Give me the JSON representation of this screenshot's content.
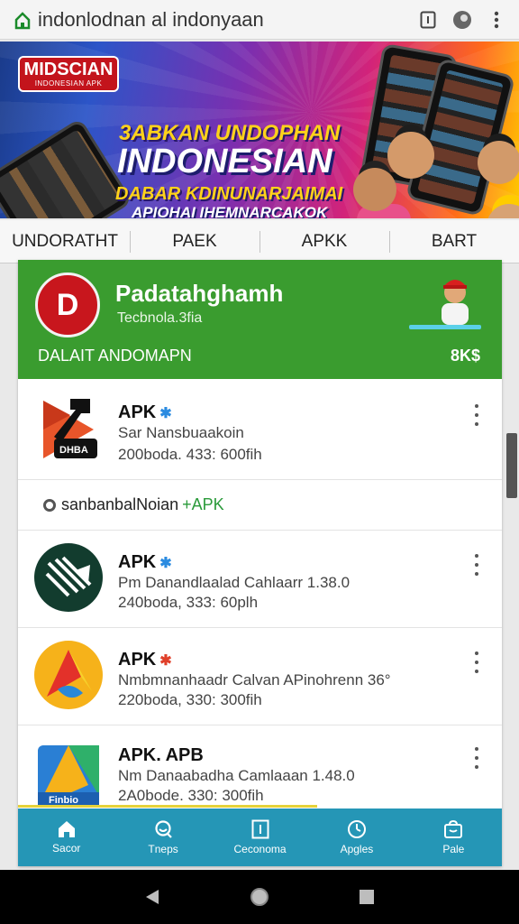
{
  "browser": {
    "url": "indonlodnan al indonyaan"
  },
  "banner": {
    "badge": "MIDSCIAN",
    "badge_sub": "INDONESIAN APK",
    "line1": "3ABKAN UNDOPHAN",
    "line2": "INDONESIAN",
    "line3": "DABAR KDINUNARJAIMAI",
    "line4": "APIOHAI IHEMNARCAKOK"
  },
  "tabs": [
    {
      "label": "UNDORATHT"
    },
    {
      "label": "PAEK"
    },
    {
      "label": "APKK"
    },
    {
      "label": "BART"
    }
  ],
  "header": {
    "logo_letter": "D",
    "title": "Padatahghamh",
    "subtitle": "Tecbnola.3fia",
    "footer_left": "DALAIT ANDOMAPN",
    "footer_right": "8K$"
  },
  "apps": [
    {
      "name": "APK",
      "desc": "Sar Nansbuaakoin",
      "meta": "200boda. 433: 600fih"
    },
    {
      "name": "APK",
      "desc": "Pm Danandlaalad Cahlaarr 1.38.0",
      "meta": "240boda, 333: 60plh"
    },
    {
      "name": "APK",
      "desc": "Nmbmnanhaadr Calvan APinohrenn 36°",
      "meta": "220boda, 330: 300fih"
    },
    {
      "name": "APK. APB",
      "desc": "Nm Danaabadha Camlaaan 1.48.0",
      "meta": "2A0bode. 330: 300fih"
    }
  ],
  "promo": {
    "text": "sanbanbalNoian",
    "tag": "+APK"
  },
  "bottom_nav": [
    {
      "label": "Sacor",
      "icon": "home-icon"
    },
    {
      "label": "Tneps",
      "icon": "search-icon"
    },
    {
      "label": "Ceconoma",
      "icon": "category-icon"
    },
    {
      "label": "Apgles",
      "icon": "clock-icon"
    },
    {
      "label": "Pale",
      "icon": "bag-icon"
    }
  ],
  "colors": {
    "header_green": "#3a9c2f",
    "nav_blue": "#2596b6",
    "logo_red": "#c8161d"
  }
}
